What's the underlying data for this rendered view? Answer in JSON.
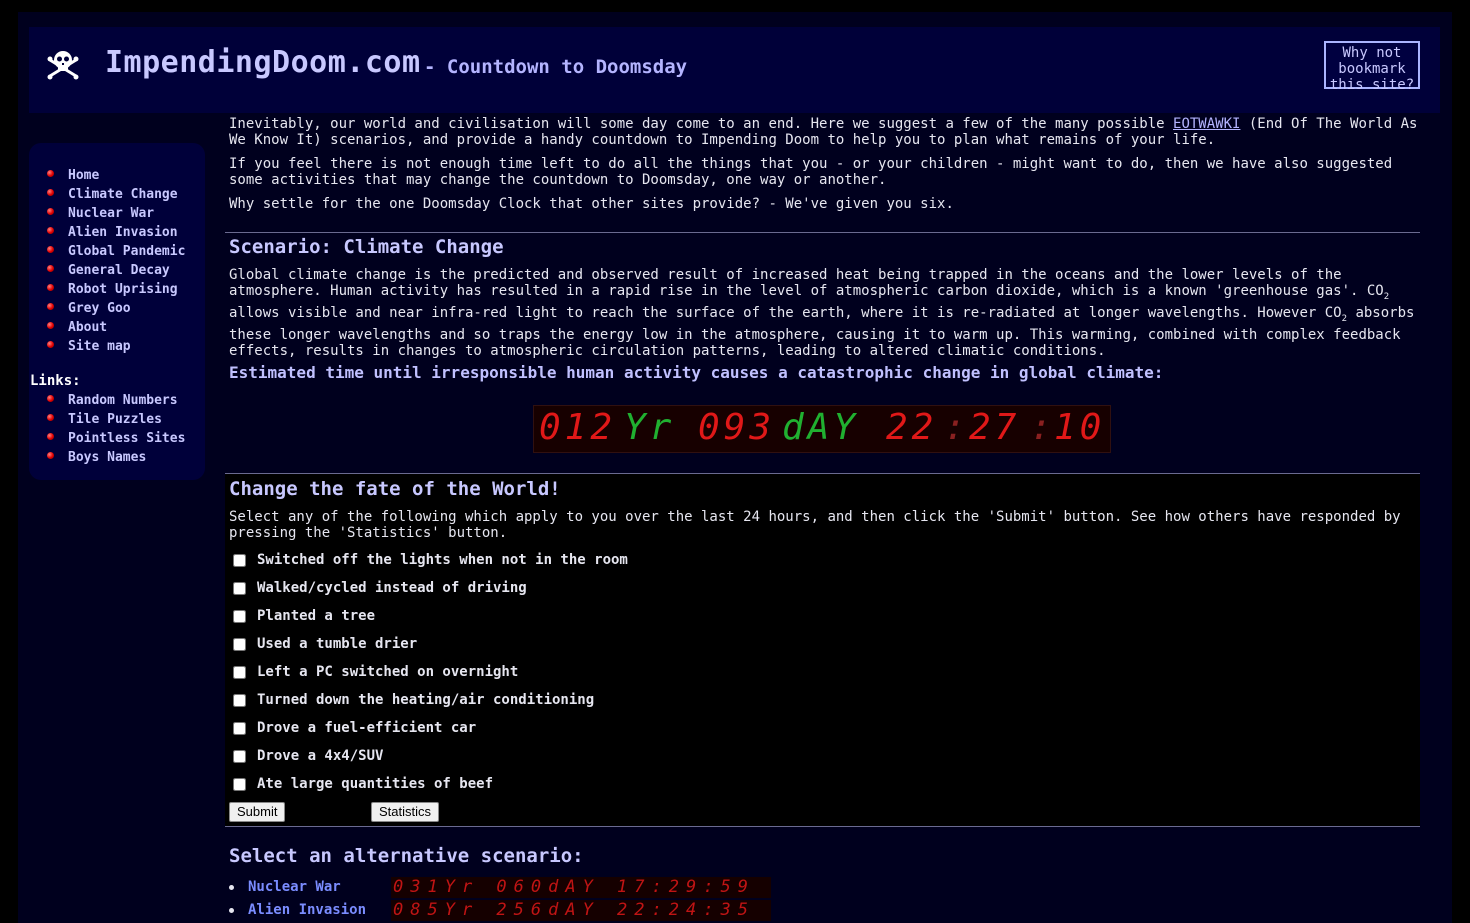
{
  "header": {
    "title": "ImpendingDoom.com",
    "subtitle": "- Countdown to Doomsday",
    "bookmark": "Why not bookmark this site?"
  },
  "nav": {
    "items": [
      "Home",
      "Climate Change",
      "Nuclear War",
      "Alien Invasion",
      "Global Pandemic",
      "General Decay",
      "Robot Uprising",
      "Grey Goo",
      "About",
      "Site map"
    ],
    "links_label": "Links:",
    "links": [
      "Random Numbers",
      "Tile Puzzles",
      "Pointless Sites",
      "Boys Names"
    ]
  },
  "intro": {
    "p1_before": "Inevitably, our world and civilisation will some day come to an end. Here we suggest a few of the many possible ",
    "p1_link": "EOTWAWKI",
    "p1_after": " (End Of The World As We Know It) scenarios, and provide a handy countdown to Impending Doom to help you to plan what remains of your life.",
    "p2": "If you feel there is not enough time left to do all the things that you - or your children - might want to do, then we have also suggested some activities that may change the countdown to Doomsday, one way or another.",
    "p3": "Why settle for the one Doomsday Clock that other sites provide? - We've given you six."
  },
  "scenario": {
    "heading": "Scenario: Climate Change",
    "text_a": "Global climate change is the predicted and observed result of increased heat being trapped in the oceans and the lower levels of the atmosphere. Human activity has resulted in a rapid rise in the level of atmospheric carbon dioxide, which is a known 'greenhouse gas'. CO",
    "sub2": "2",
    "text_b": " allows visible and near infra-red light to reach the surface of the earth, where it is re-radiated at longer wavelengths. However CO",
    "text_c": " absorbs these longer wavelengths and so traps the energy low in the atmosphere, causing it to warm up. This warming, combined with complex feedback effects, results in changes to atmospheric circulation patterns, leading to altered climatic conditions.",
    "estimate": "Estimated time until irresponsible human activity causes a catastrophic change in global climate:",
    "countdown": {
      "years": "012",
      "yr_label": "Yr",
      "days": "093",
      "day_label": "dAY",
      "hours": "22",
      "minutes": "27",
      "seconds": "10"
    }
  },
  "fate": {
    "heading": "Change the fate of the World!",
    "intro": "Select any of the following which apply to you over the last 24 hours, and then click the 'Submit' button. See how others have responded by pressing the 'Statistics' button.",
    "options": [
      "Switched off the lights when not in the room",
      "Walked/cycled instead of driving",
      "Planted a tree",
      "Used a tumble drier",
      "Left a PC switched on overnight",
      "Turned down the heating/air conditioning",
      "Drove a fuel-efficient car",
      "Drove a 4x4/SUV",
      "Ate large quantities of beef"
    ],
    "submit": "Submit",
    "statistics": "Statistics"
  },
  "alternatives": {
    "heading": "Select an alternative scenario:",
    "items": [
      {
        "name": "Nuclear War",
        "countdown": "031Yr 060dAY 17:29:59"
      },
      {
        "name": "Alien Invasion",
        "countdown": "085Yr 256dAY 22:24:35"
      }
    ]
  },
  "colors": {
    "segment_red": "#e01818",
    "segment_green": "#20b030",
    "accent": "#c8c8ff",
    "link": "#7a8cff"
  }
}
